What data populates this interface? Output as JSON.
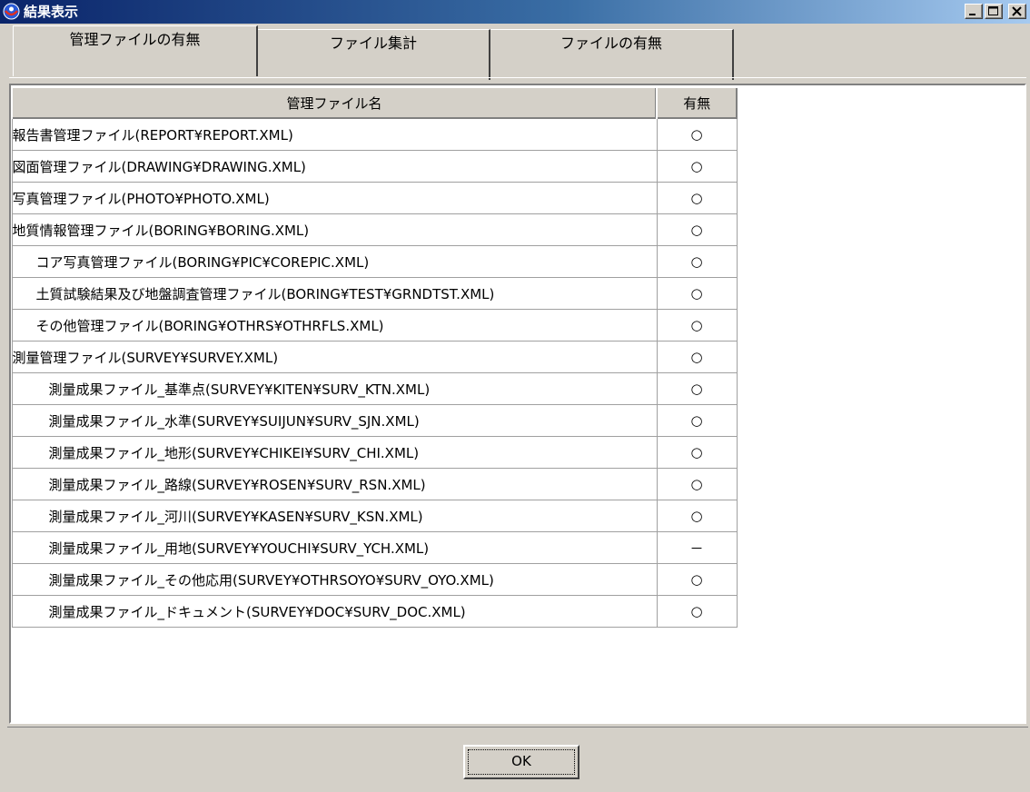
{
  "window": {
    "title": "結果表示"
  },
  "tabs": [
    {
      "label": "管理ファイルの有無",
      "active": true
    },
    {
      "label": "ファイル集計",
      "active": false
    },
    {
      "label": "ファイルの有無",
      "active": false
    }
  ],
  "table": {
    "headers": {
      "name": "管理ファイル名",
      "value": "有無"
    },
    "rows": [
      {
        "name": "報告書管理ファイル(REPORT¥REPORT.XML)",
        "value": "○",
        "level": 0
      },
      {
        "name": "図面管理ファイル(DRAWING¥DRAWING.XML)",
        "value": "○",
        "level": 0
      },
      {
        "name": "写真管理ファイル(PHOTO¥PHOTO.XML)",
        "value": "○",
        "level": 0
      },
      {
        "name": "地質情報管理ファイル(BORING¥BORING.XML)",
        "value": "○",
        "level": 0
      },
      {
        "name": "コア写真管理ファイル(BORING¥PIC¥COREPIC.XML)",
        "value": "○",
        "level": 1
      },
      {
        "name": "土質試験結果及び地盤調査管理ファイル(BORING¥TEST¥GRNDTST.XML)",
        "value": "○",
        "level": 1
      },
      {
        "name": "その他管理ファイル(BORING¥OTHRS¥OTHRFLS.XML)",
        "value": "○",
        "level": 1
      },
      {
        "name": "測量管理ファイル(SURVEY¥SURVEY.XML)",
        "value": "○",
        "level": 0
      },
      {
        "name": "測量成果ファイル_基準点(SURVEY¥KITEN¥SURV_KTN.XML)",
        "value": "○",
        "level": 2
      },
      {
        "name": "測量成果ファイル_水準(SURVEY¥SUIJUN¥SURV_SJN.XML)",
        "value": "○",
        "level": 2
      },
      {
        "name": "測量成果ファイル_地形(SURVEY¥CHIKEI¥SURV_CHI.XML)",
        "value": "○",
        "level": 2
      },
      {
        "name": "測量成果ファイル_路線(SURVEY¥ROSEN¥SURV_RSN.XML)",
        "value": "○",
        "level": 2
      },
      {
        "name": "測量成果ファイル_河川(SURVEY¥KASEN¥SURV_KSN.XML)",
        "value": "○",
        "level": 2
      },
      {
        "name": "測量成果ファイル_用地(SURVEY¥YOUCHI¥SURV_YCH.XML)",
        "value": "－",
        "level": 2
      },
      {
        "name": "測量成果ファイル_その他応用(SURVEY¥OTHRSOYO¥SURV_OYO.XML)",
        "value": "○",
        "level": 2
      },
      {
        "name": "測量成果ファイル_ドキュメント(SURVEY¥DOC¥SURV_DOC.XML)",
        "value": "○",
        "level": 2
      }
    ]
  },
  "buttons": {
    "ok": "OK"
  },
  "icons": {
    "app": "app-logo-icon",
    "minimize": "minimize-icon",
    "maximize": "maximize-icon",
    "close": "close-icon"
  }
}
